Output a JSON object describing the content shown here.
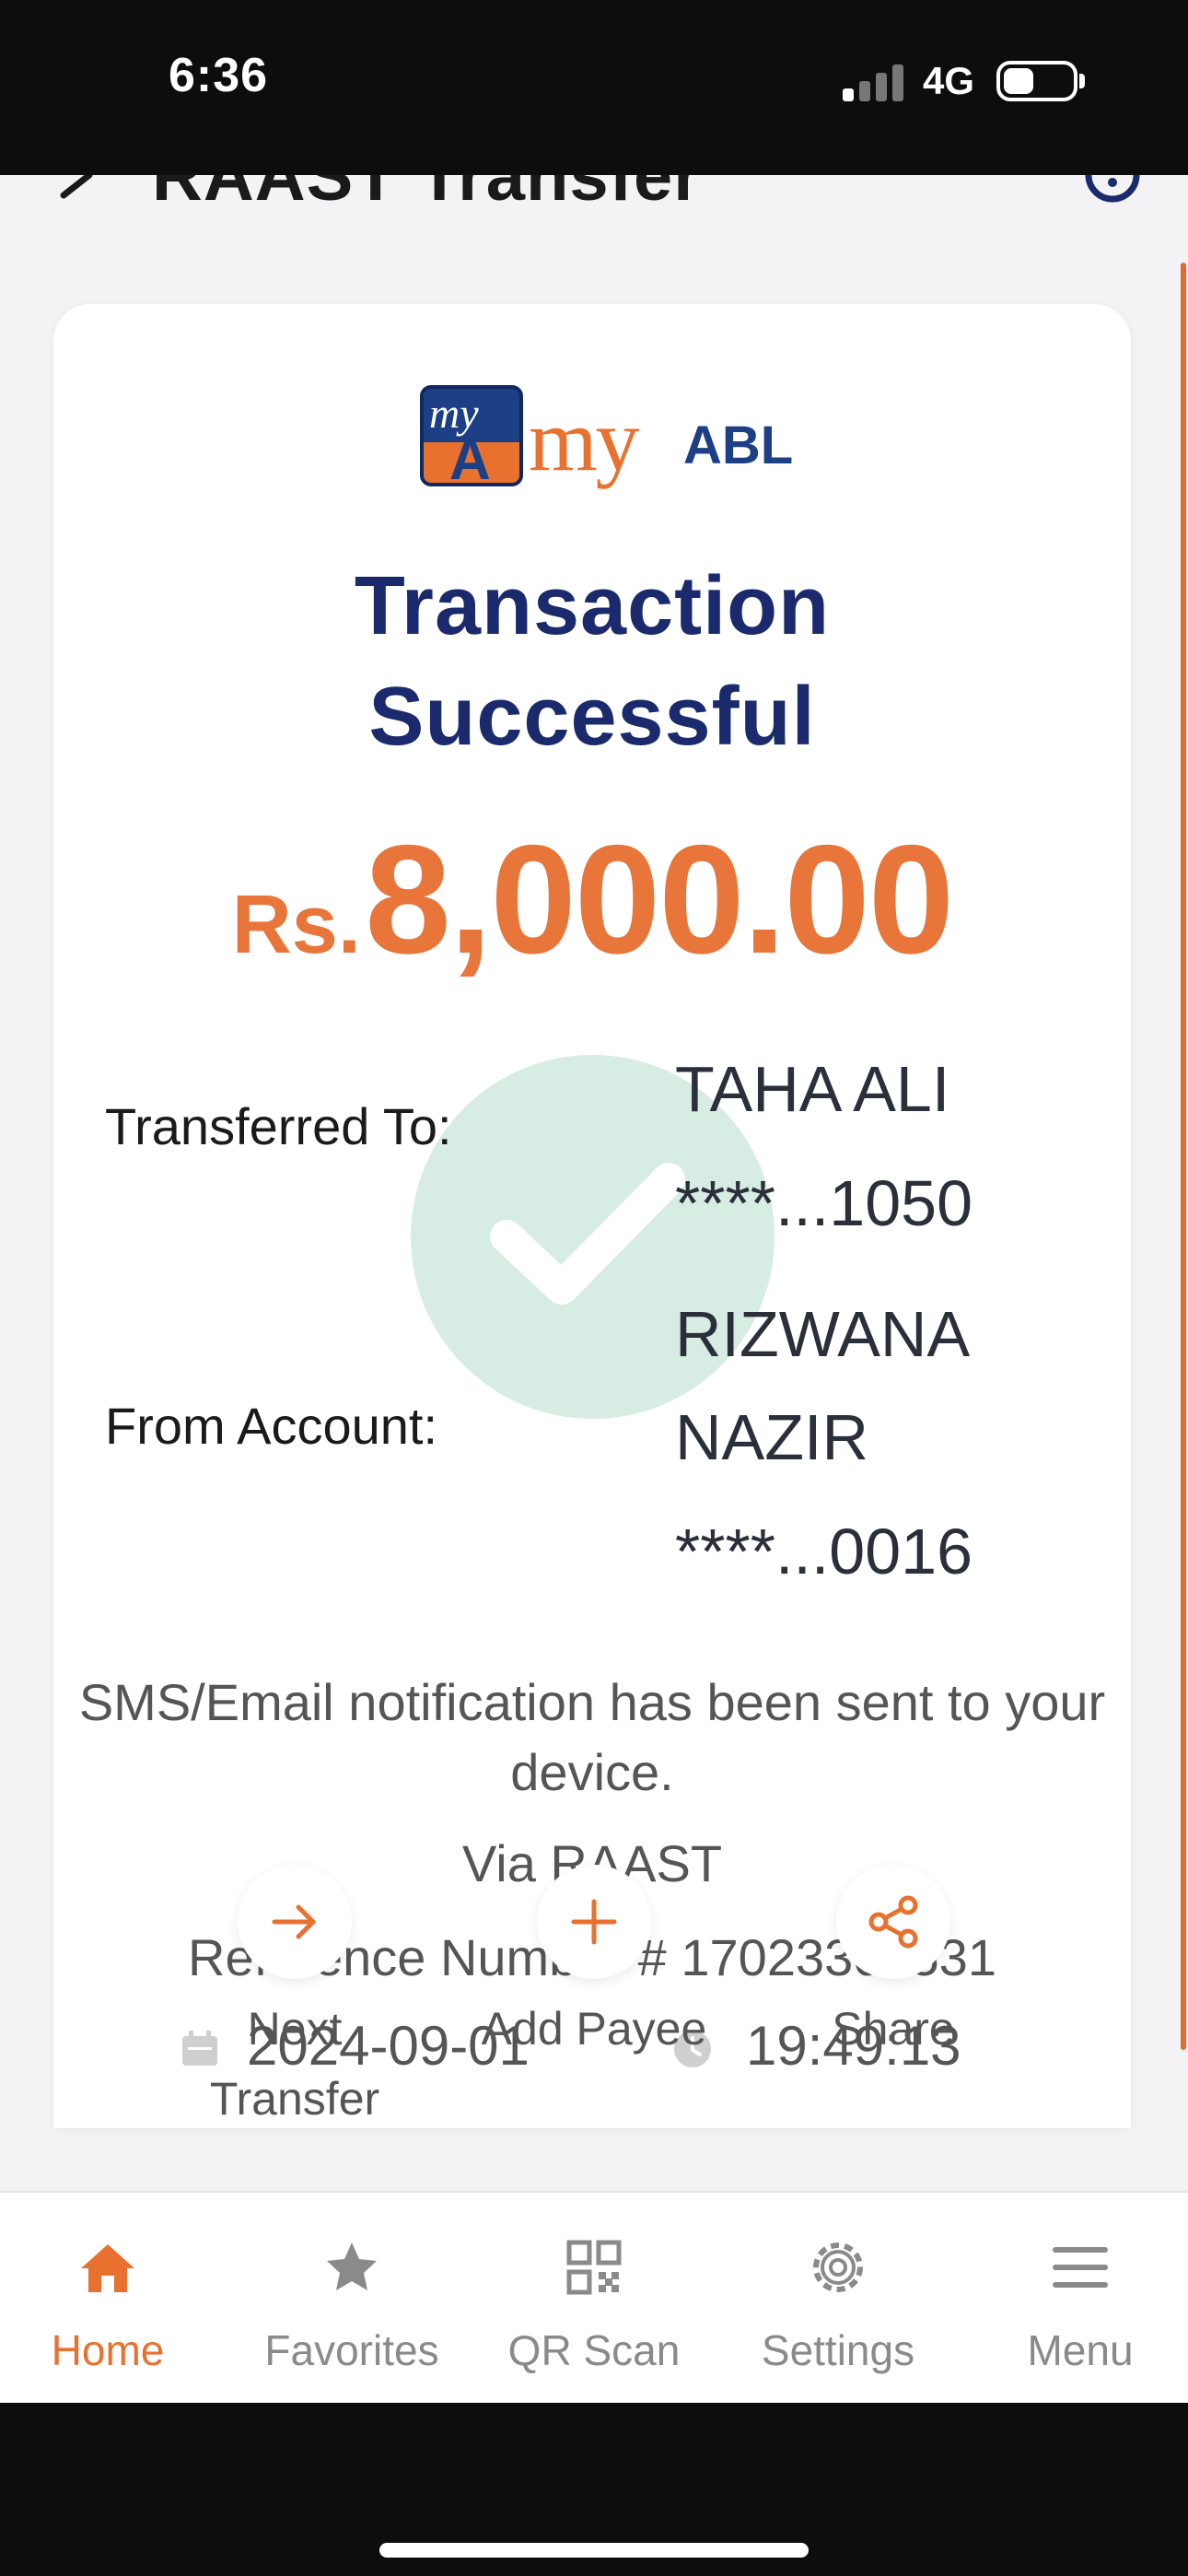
{
  "status_bar": {
    "time": "6:36",
    "network": "4G"
  },
  "header": {
    "title": "RAAST Transfer"
  },
  "receipt": {
    "logo": {
      "box_top": "my",
      "box_letter": "A",
      "wordmark_my": "my",
      "wordmark_abl": "ABL"
    },
    "title": "Transaction Successful",
    "currency": "Rs.",
    "amount": "8,000.00",
    "transferred_to": {
      "label": "Transferred To:",
      "name": "TAHA ALI",
      "account": "****...1050"
    },
    "from_account": {
      "label": "From Account:",
      "name_line1": "RIZWANA",
      "name_line2": "NAZIR",
      "account": "****...0016"
    },
    "notification": "SMS/Email notification has been sent to your device.",
    "via": "Via RAAST",
    "reference": "Reference Number # 17023307531",
    "date": "2024-09-01",
    "time": "19:49:13"
  },
  "actions": [
    {
      "label": "Next Transfer",
      "icon": "arrow-right-icon"
    },
    {
      "label": "Add Payee",
      "icon": "plus-icon"
    },
    {
      "label": "Share",
      "icon": "share-icon"
    }
  ],
  "bottom_nav": [
    {
      "label": "Home",
      "icon": "home-icon",
      "active": true
    },
    {
      "label": "Favorites",
      "icon": "star-icon",
      "active": false
    },
    {
      "label": "QR Scan",
      "icon": "qr-code-icon",
      "active": false
    },
    {
      "label": "Settings",
      "icon": "gear-icon",
      "active": false
    },
    {
      "label": "Menu",
      "icon": "hamburger-menu-icon",
      "active": false
    }
  ],
  "colors": {
    "accent": "#e8712f",
    "title_navy": "#1a2a6c",
    "success_green": "#cae6d8"
  }
}
